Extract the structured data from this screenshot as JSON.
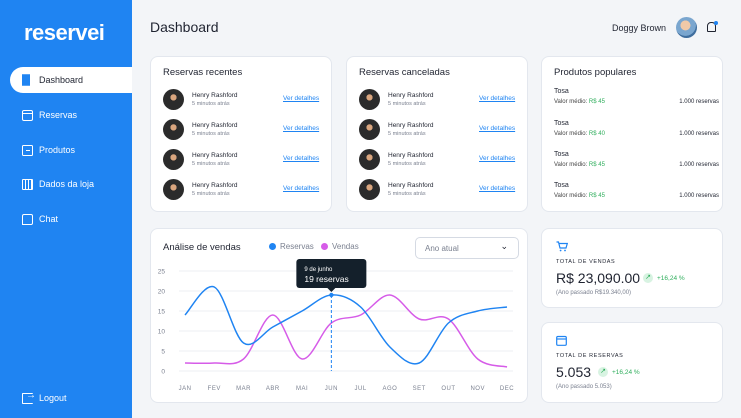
{
  "brand": {
    "logo": "reservei"
  },
  "sidebar": {
    "items": [
      {
        "label": "Dashboard",
        "icon": "grid-icon"
      },
      {
        "label": "Reservas",
        "icon": "calendar-icon"
      },
      {
        "label": "Produtos",
        "icon": "box-icon"
      },
      {
        "label": "Dados da loja",
        "icon": "building-icon"
      },
      {
        "label": "Chat",
        "icon": "chat-icon"
      }
    ],
    "logout": "Logout"
  },
  "header": {
    "title": "Dashboard",
    "user_name": "Doggy Brown"
  },
  "recent": {
    "title": "Reservas recentes",
    "rows": [
      {
        "name": "Henry Rashford",
        "time": "5 minutos atrás",
        "link": "Ver detalhes"
      },
      {
        "name": "Henry Rashford",
        "time": "5 minutos atrás",
        "link": "Ver detalhes"
      },
      {
        "name": "Henry Rashford",
        "time": "5 minutos atrás",
        "link": "Ver detalhes"
      },
      {
        "name": "Henry Rashford",
        "time": "5 minutos atrás",
        "link": "Ver detalhes"
      }
    ]
  },
  "canceled": {
    "title": "Reservas canceladas",
    "rows": [
      {
        "name": "Henry Rashford",
        "time": "5 minutos atrás",
        "link": "Ver detalhes"
      },
      {
        "name": "Henry Rashford",
        "time": "5 minutos atrás",
        "link": "Ver detalhes"
      },
      {
        "name": "Henry Rashford",
        "time": "5 minutos atrás",
        "link": "Ver detalhes"
      },
      {
        "name": "Henry Rashford",
        "time": "5 minutos atrás",
        "link": "Ver detalhes"
      }
    ]
  },
  "popular": {
    "title": "Produtos populares",
    "items": [
      {
        "name": "Tosa",
        "price_label": "Valor médio:",
        "price": "R$ 45",
        "qty": "1.000 reservas"
      },
      {
        "name": "Tosa",
        "price_label": "Valor médio:",
        "price": "R$ 40",
        "qty": "1.000 reservas"
      },
      {
        "name": "Tosa",
        "price_label": "Valor médio:",
        "price": "R$ 45",
        "qty": "1.000 reservas"
      },
      {
        "name": "Tosa",
        "price_label": "Valor médio:",
        "price": "R$ 45",
        "qty": "1.000 reservas"
      }
    ]
  },
  "sales": {
    "title": "Análise de vendas",
    "legend_reservas": "Reservas",
    "legend_vendas": "Vendas",
    "select_value": "Ano atual",
    "tooltip_date": "9 de junho",
    "tooltip_value": "19 reservas"
  },
  "stats": {
    "vendas": {
      "label": "TOTAL DE VENDAS",
      "value": "R$ 23,090.00",
      "change": "+16,24 %",
      "previous": "(Ano passado R$19.340,00)"
    },
    "reservas": {
      "label": "TOTAL DE RESERVAS",
      "value": "5.053",
      "change": "+16,24 %",
      "previous": "(Ano passado 5.053)"
    }
  },
  "colors": {
    "accent": "#1f84f2",
    "reservas": "#1f84f2",
    "vendas": "#d65ce8",
    "positive": "#2fae5c"
  },
  "chart_data": {
    "type": "line",
    "categories": [
      "JAN",
      "FEV",
      "MAR",
      "ABR",
      "MAI",
      "JUN",
      "JUL",
      "AGO",
      "SET",
      "OUT",
      "NOV",
      "DEC"
    ],
    "yticks": [
      0,
      5,
      10,
      15,
      20,
      25
    ],
    "ylim": [
      0,
      25
    ],
    "series": [
      {
        "name": "Reservas",
        "values": [
          14,
          21,
          7,
          11,
          15,
          19,
          16,
          6,
          2,
          12,
          15,
          16
        ]
      },
      {
        "name": "Vendas",
        "values": [
          2,
          2,
          3,
          14,
          3,
          12,
          14,
          19,
          13,
          13,
          3,
          1
        ]
      }
    ],
    "grid": true,
    "highlight": {
      "category": "JUN",
      "value": 19
    }
  }
}
